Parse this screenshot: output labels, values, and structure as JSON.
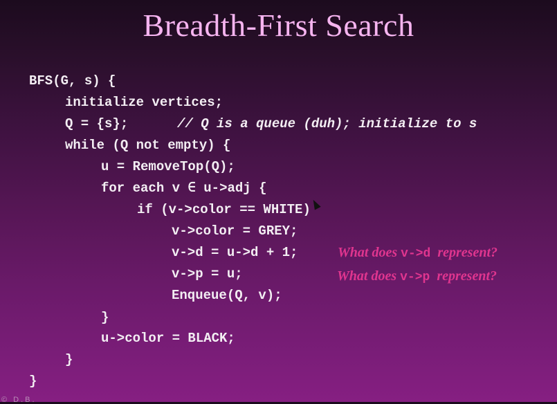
{
  "slide": {
    "title": "Breadth-First Search",
    "code": [
      "BFS(G, s) {",
      "initialize vertices;",
      "Q = {s};",
      "// Q is a queue (duh); initialize to s",
      "while (Q not empty) {",
      "u = RemoveTop(Q);",
      "for each v ∈ u->adj {",
      "if (v->color == WHITE)",
      "v->color = GREY;",
      "v->d = u->d + 1;",
      "v->p = u;",
      "Enqueue(Q, v);",
      "}",
      "u->color = BLACK;",
      "}",
      "}"
    ],
    "questions": [
      {
        "pre": "What does ",
        "code": "v->d",
        "post": "  represent?"
      },
      {
        "pre": "What does ",
        "code": "v->p",
        "post": "  represent?"
      }
    ],
    "footer": "© D.B."
  },
  "colors": {
    "title": "#f6b4f0",
    "code": "#f3eef3",
    "question": "#e0358f",
    "background_top": "#1c0b1e",
    "background_bottom": "#861f82"
  }
}
